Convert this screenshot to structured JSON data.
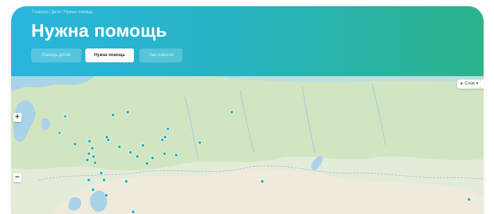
{
  "header": {
    "breadcrumb": "Главная / Дети / Нужна помощь",
    "title": "Нужна помощь"
  },
  "tabs": [
    {
      "label": "Помощь детям",
      "active": false
    },
    {
      "label": "Нужна помощь",
      "active": true
    },
    {
      "label": "Уже помогли",
      "active": false
    }
  ],
  "map": {
    "zoom_in_label": "+",
    "zoom_out_label": "−",
    "layers_label": "Слои",
    "layers_icon": "layers-icon",
    "marker_color": "#1fb5b5",
    "land_color": "#e3ecd9",
    "forest_color": "#cfe3bf",
    "water_color": "#a9d3e8",
    "steppe_color": "#efeadc"
  },
  "colors": {
    "hero_start": "#29b6dc",
    "hero_end": "#2bb38a"
  }
}
